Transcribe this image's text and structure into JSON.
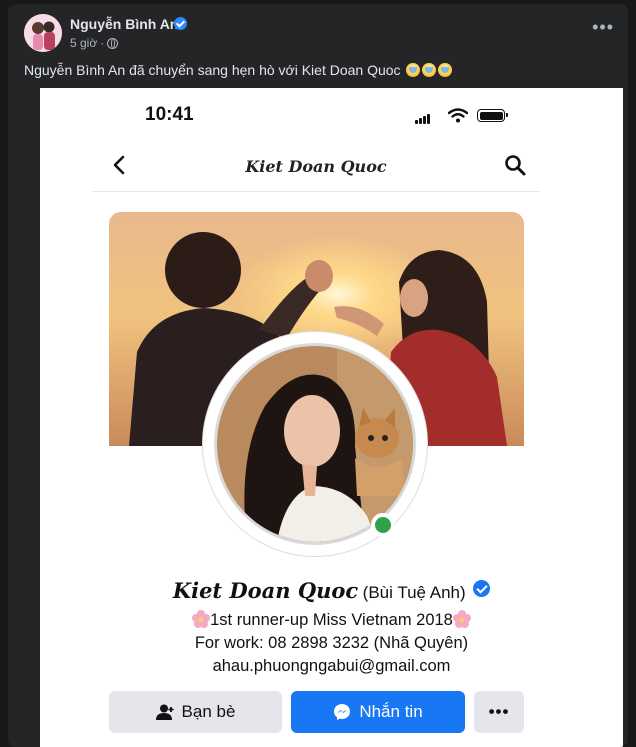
{
  "post": {
    "author_name": "Nguyễn Bình An",
    "time": "5 giờ",
    "separator": "·",
    "text": "Nguyễn Bình An đã chuyển sang hẹn hò với Kiet Doan Quoc",
    "more_label": "•••"
  },
  "phone": {
    "status_time": "10:41",
    "nav_title": "Kiet Doan Quoc",
    "profile": {
      "name": "Kiet Doan Quoc",
      "alt_name": "(Bùi Tuệ Anh)",
      "bio_line1": "1st runner-up Miss Vietnam 2018",
      "bio_line2": "For work: 08 2898 3232 (Nhã Quyên)",
      "bio_line3": "ahau.phuongngabui@gmail.com"
    },
    "buttons": {
      "friends": "Bạn bè",
      "message": "Nhắn tin",
      "more": "•••"
    }
  },
  "colors": {
    "facebook_blue": "#1877f2",
    "dark_card": "#242526",
    "online_green": "#31a24c"
  },
  "icons": [
    "verified-badge-icon",
    "globe-icon",
    "more-icon",
    "back-arrow-icon",
    "search-icon",
    "wifi-icon",
    "signal-icon",
    "battery-icon",
    "add-friend-icon",
    "messenger-icon",
    "flower-icon",
    "crying-emoji-icon"
  ]
}
